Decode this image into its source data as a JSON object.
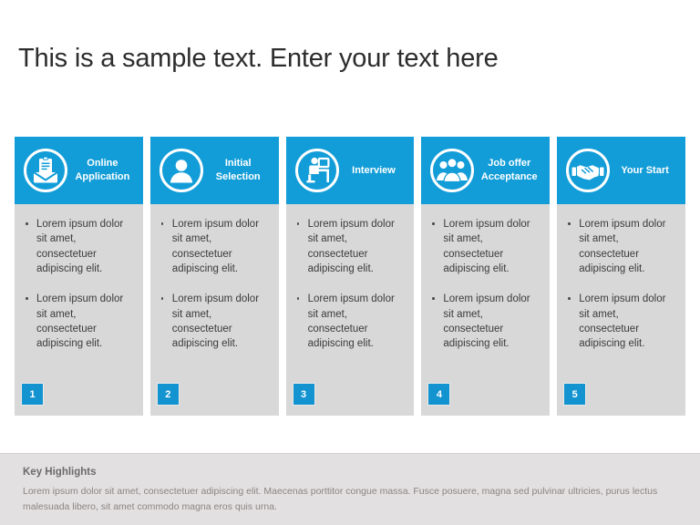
{
  "slide": {
    "title": "This is a sample text. Enter your text here",
    "accent_color": "#139dd8",
    "card_body_color": "#d8d8d8",
    "footer_color": "#e2e0e0"
  },
  "process": {
    "cards": [
      {
        "icon": "envelope-document-icon",
        "label": "Online Application",
        "number": "1",
        "bullets": [
          "Lorem ipsum dolor sit amet, consectetuer adipiscing elit.",
          "Lorem ipsum dolor sit amet, consectetuer adipiscing elit."
        ]
      },
      {
        "icon": "person-icon",
        "label": "Initial Selection",
        "number": "2",
        "bullets": [
          "Lorem ipsum dolor sit amet, consectetuer adipiscing elit.",
          "Lorem ipsum dolor sit amet, consectetuer adipiscing elit."
        ]
      },
      {
        "icon": "person-at-desk-icon",
        "label": "Interview",
        "number": "3",
        "bullets": [
          "Lorem ipsum dolor sit amet, consectetuer adipiscing elit.",
          "Lorem ipsum dolor sit amet, consectetuer adipiscing elit."
        ]
      },
      {
        "icon": "group-of-people-icon",
        "label": "Job offer Acceptance",
        "number": "4",
        "bullets": [
          "Lorem ipsum dolor sit amet, consectetuer adipiscing elit.",
          "Lorem ipsum dolor sit amet, consectetuer adipiscing elit."
        ]
      },
      {
        "icon": "handshake-icon",
        "label": "Your Start",
        "number": "5",
        "bullets": [
          "Lorem ipsum dolor sit amet, consectetuer adipiscing elit.",
          "Lorem ipsum dolor sit amet, consectetuer adipiscing elit."
        ]
      }
    ]
  },
  "key_highlights": {
    "title": "Key Highlights",
    "body": "Lorem ipsum dolor sit amet, consectetuer adipiscing elit. Maecenas porttitor congue massa. Fusce posuere, magna sed pulvinar ultricies, purus lectus malesuada libero, sit amet commodo  magna eros quis urna."
  }
}
